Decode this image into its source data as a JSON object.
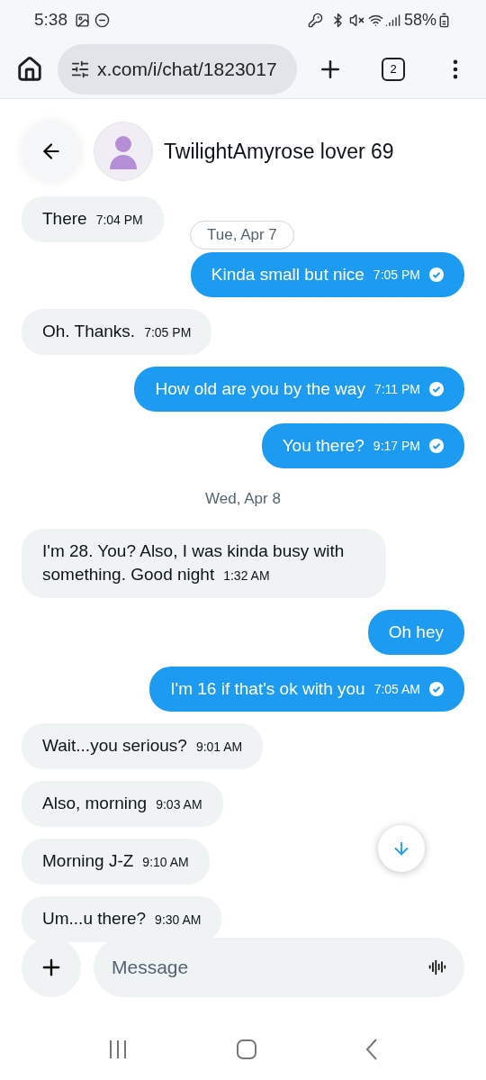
{
  "status_bar": {
    "time": "5:38",
    "battery": "58%"
  },
  "browser": {
    "url": "x.com/i/chat/1823017",
    "tab_count": "2"
  },
  "chat_header": {
    "name": "TwilightAmyrose lover 69"
  },
  "messages": [
    {
      "kind": "incoming",
      "text": "There",
      "time": "7:04 PM"
    },
    {
      "kind": "date",
      "text": "Tue, Apr 7",
      "floating": true
    },
    {
      "kind": "outgoing",
      "text": "Kinda small but nice",
      "time": "7:05 PM",
      "read": true
    },
    {
      "kind": "incoming",
      "text": "Oh. Thanks.",
      "time": "7:05 PM"
    },
    {
      "kind": "outgoing",
      "text": "How old are you by the way",
      "time": "7:11 PM",
      "read": true
    },
    {
      "kind": "outgoing",
      "text": "You there?",
      "time": "9:17 PM",
      "read": true
    },
    {
      "kind": "date",
      "text": "Wed, Apr 8",
      "floating": false
    },
    {
      "kind": "incoming",
      "text": "I'm 28. You? Also, I was kinda busy with something. Good night",
      "time": "1:32 AM"
    },
    {
      "kind": "outgoing",
      "text": "Oh hey",
      "read": false
    },
    {
      "kind": "outgoing",
      "text": "I'm 16 if that's ok with you",
      "time": "7:05 AM",
      "read": true
    },
    {
      "kind": "incoming",
      "text": "Wait...you serious?",
      "time": "9:01 AM"
    },
    {
      "kind": "incoming",
      "text": "Also, morning",
      "time": "9:03 AM"
    },
    {
      "kind": "incoming",
      "text": "Morning J-Z",
      "time": "9:10 AM"
    },
    {
      "kind": "incoming",
      "text": "Um...u there?",
      "time": "9:30 AM"
    }
  ],
  "composer": {
    "placeholder": "Message"
  }
}
